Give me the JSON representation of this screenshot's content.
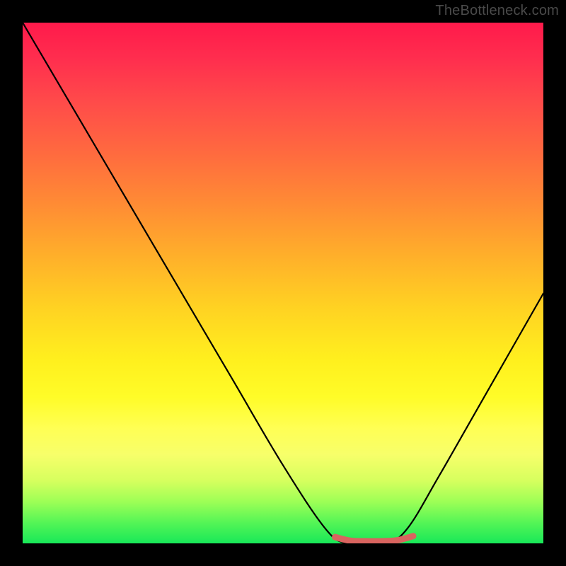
{
  "watermark": "TheBottleneck.com",
  "chart_data": {
    "type": "line",
    "title": "",
    "xlabel": "",
    "ylabel": "",
    "xlim": [
      0,
      100
    ],
    "ylim": [
      0,
      100
    ],
    "series": [
      {
        "name": "bottleneck-curve",
        "x": [
          0,
          10,
          20,
          30,
          40,
          50,
          58,
          62,
          66,
          70,
          74,
          80,
          88,
          100
        ],
        "values": [
          100,
          83,
          66,
          49,
          32,
          15,
          3,
          0,
          0,
          0,
          3,
          13,
          27,
          48
        ]
      }
    ],
    "highlight": {
      "name": "optimal-range",
      "x": [
        60,
        63,
        66,
        69,
        72,
        75
      ],
      "values": [
        1.2,
        0.5,
        0.4,
        0.4,
        0.6,
        1.4
      ]
    },
    "gradient_stops": [
      {
        "pct": 0,
        "color": "#ff1a4b"
      },
      {
        "pct": 15,
        "color": "#ff4a4a"
      },
      {
        "pct": 35,
        "color": "#ff8c34"
      },
      {
        "pct": 55,
        "color": "#ffd322"
      },
      {
        "pct": 72,
        "color": "#fffc28"
      },
      {
        "pct": 88,
        "color": "#d6ff5e"
      },
      {
        "pct": 100,
        "color": "#18e858"
      }
    ]
  }
}
